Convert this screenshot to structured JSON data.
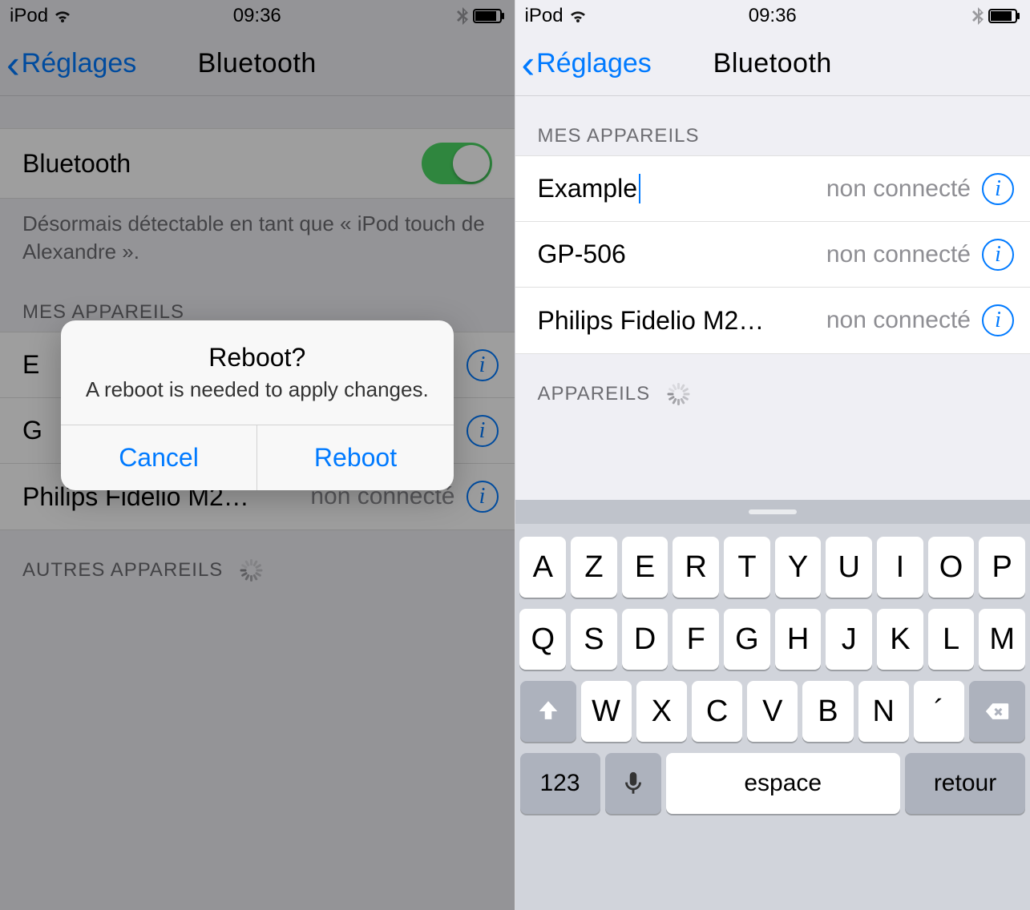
{
  "status": {
    "carrier": "iPod",
    "time": "09:36"
  },
  "nav": {
    "back": "Réglages",
    "title": "Bluetooth"
  },
  "left": {
    "bt_row_label": "Bluetooth",
    "bt_on": true,
    "discoverable_text": "Désormais détectable en tant que « iPod touch de Alexandre ».",
    "my_devices_header": "MES APPAREILS",
    "other_devices_header": "AUTRES APPAREILS",
    "devices": [
      {
        "name": "E",
        "status": "",
        "truncated": true
      },
      {
        "name": "G",
        "status": "",
        "truncated": true
      },
      {
        "name": "Philips Fidelio M2…",
        "status": "non connecté",
        "truncated": true
      }
    ],
    "alert": {
      "title": "Reboot?",
      "message": "A reboot is needed to apply changes.",
      "cancel": "Cancel",
      "confirm": "Reboot"
    }
  },
  "right": {
    "my_devices_header": "MES APPAREILS",
    "appareils_header": "APPAREILS",
    "devices": [
      {
        "name": "Example",
        "status": "non connecté",
        "editing": true
      },
      {
        "name": "GP-506",
        "status": "non connecté"
      },
      {
        "name": "Philips Fidelio M2…",
        "status": "non connecté"
      }
    ],
    "keyboard": {
      "row1": [
        "A",
        "Z",
        "E",
        "R",
        "T",
        "Y",
        "U",
        "I",
        "O",
        "P"
      ],
      "row2": [
        "Q",
        "S",
        "D",
        "F",
        "G",
        "H",
        "J",
        "K",
        "L",
        "M"
      ],
      "row3": [
        "W",
        "X",
        "C",
        "V",
        "B",
        "N",
        "´"
      ],
      "numKey": "123",
      "spaceKey": "espace",
      "returnKey": "retour"
    }
  }
}
